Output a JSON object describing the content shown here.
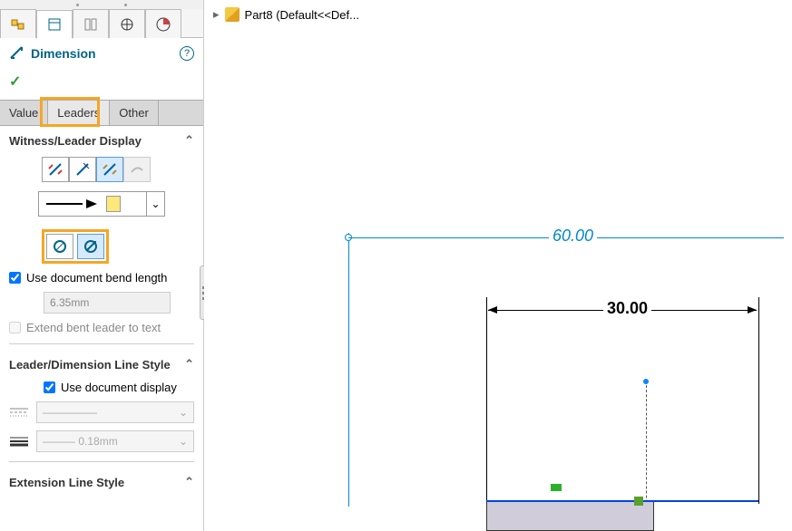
{
  "header": {
    "part_label": "Part8 (Default<<Def..."
  },
  "panel": {
    "title": "Dimension",
    "tabs": {
      "value": "Value",
      "leaders": "Leaders",
      "other": "Other"
    },
    "section1": {
      "title": "Witness/Leader Display",
      "bend_checkbox": "Use document bend length",
      "bend_value": "6.35mm",
      "extend_checkbox": "Extend bent leader to text"
    },
    "section2": {
      "title": "Leader/Dimension Line Style",
      "doc_display": "Use document display",
      "thickness": "0.18mm"
    },
    "section3": {
      "title": "Extension Line Style"
    }
  },
  "drawing": {
    "dim1_value": "60.00",
    "dim2_value": "30.00"
  }
}
